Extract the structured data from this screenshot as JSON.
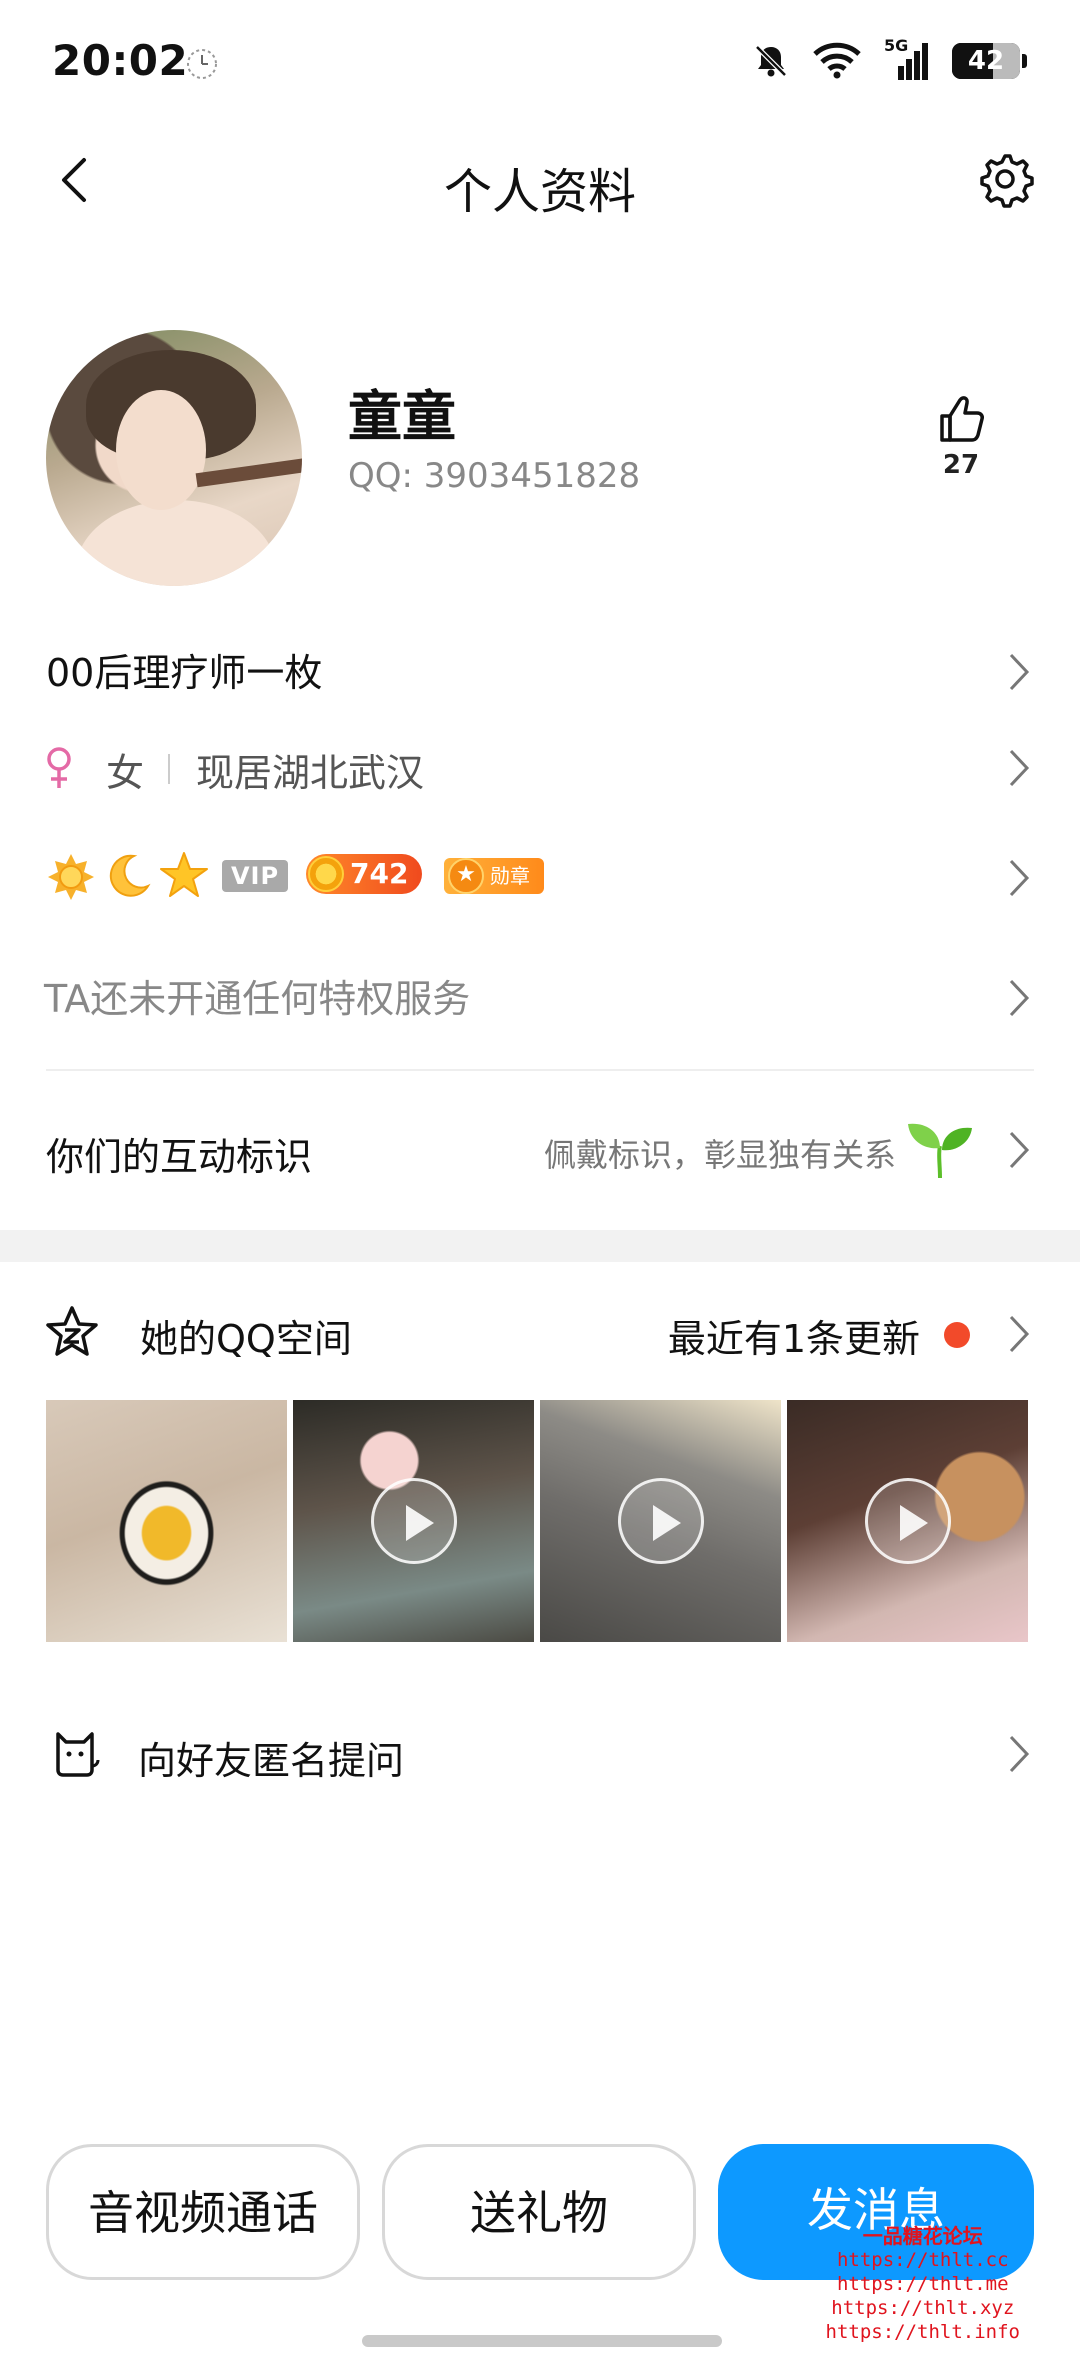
{
  "status_bar": {
    "time": "20:02",
    "network": "5G",
    "battery": "42"
  },
  "header": {
    "title": "个人资料"
  },
  "profile": {
    "nickname": "童童",
    "qq_label": "QQ: 3903451828",
    "likes": "27"
  },
  "bio": "00后理疗师一枚",
  "info": {
    "gender": "女",
    "location": "现居湖北武汉"
  },
  "badges": {
    "vip_label": "VIP",
    "level_value": "742",
    "medal_label": "勋章"
  },
  "privilege_text": "TA还未开通任何特权服务",
  "interaction": {
    "title": "你们的互动标识",
    "subtitle": "佩戴标识，彰显独有关系"
  },
  "qzone": {
    "title": "她的QQ空间",
    "update_text": "最近有1条更新"
  },
  "ask": {
    "title": "向好友匿名提问"
  },
  "actions": {
    "call": "音视频通话",
    "gift": "送礼物",
    "message": "发消息"
  },
  "watermark": {
    "title": "一品糖花论坛",
    "lines": [
      "https://thlt.cc",
      "https://thlt.me",
      "https://thlt.xyz",
      "https://thlt.info"
    ]
  },
  "colors": {
    "primary_blue": "#0d99ff",
    "notification_red": "#f24a2a",
    "female_pink": "#e46aa6"
  }
}
